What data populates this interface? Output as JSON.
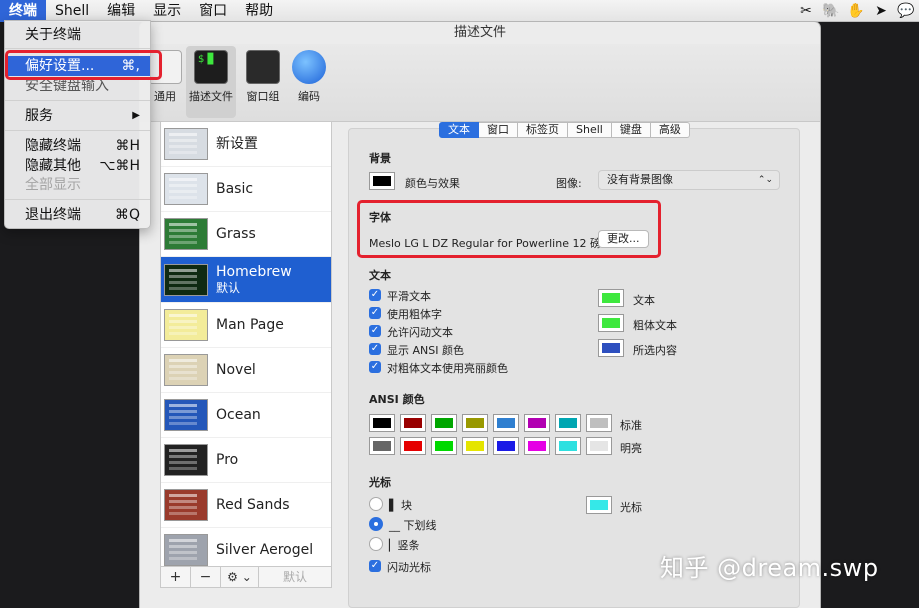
{
  "menubar": {
    "app": "终端",
    "items": [
      "Shell",
      "编辑",
      "显示",
      "窗口",
      "帮助"
    ],
    "status_icons": [
      "scissors-icon",
      "evernote-icon",
      "hand-icon",
      "send-icon",
      "wechat-icon"
    ]
  },
  "app_menu": {
    "items": [
      {
        "label": "关于终端",
        "shortcut": ""
      },
      {
        "label": "偏好设置...",
        "shortcut": "⌘,"
      },
      {
        "label": "安全键盘输入",
        "shortcut": ""
      },
      {
        "label": "服务",
        "shortcut": "▶"
      },
      {
        "label": "隐藏终端",
        "shortcut": "⌘H"
      },
      {
        "label": "隐藏其他",
        "shortcut": "⌥⌘H"
      },
      {
        "label": "全部显示",
        "shortcut": ""
      },
      {
        "label": "退出终端",
        "shortcut": "⌘Q"
      }
    ]
  },
  "window": {
    "title": "描述文件",
    "toolbar": [
      "通用",
      "描述文件",
      "窗口组",
      "编码"
    ]
  },
  "profiles": [
    {
      "name": "新设置",
      "sub": "",
      "thumb": "#d7dce2"
    },
    {
      "name": "Basic",
      "sub": "",
      "thumb": "#dde3ea"
    },
    {
      "name": "Grass",
      "sub": "",
      "thumb": "#2d7b36"
    },
    {
      "name": "Homebrew",
      "sub": "默认",
      "thumb": "#0f2a12"
    },
    {
      "name": "Man Page",
      "sub": "",
      "thumb": "#f3ec9a"
    },
    {
      "name": "Novel",
      "sub": "",
      "thumb": "#dcd2b5"
    },
    {
      "name": "Ocean",
      "sub": "",
      "thumb": "#2457b9"
    },
    {
      "name": "Pro",
      "sub": "",
      "thumb": "#222222"
    },
    {
      "name": "Red Sands",
      "sub": "",
      "thumb": "#9a3b2c"
    },
    {
      "name": "Silver Aerogel",
      "sub": "",
      "thumb": "#9ea3ad"
    }
  ],
  "list_buttons": {
    "add": "+",
    "remove": "−",
    "gear": "⚙ ⌄",
    "default": "默认"
  },
  "tabs": [
    {
      "label": "文本",
      "active": true
    },
    {
      "label": "窗口",
      "active": false
    },
    {
      "label": "标签页",
      "active": false
    },
    {
      "label": "Shell",
      "active": false
    },
    {
      "label": "键盘",
      "active": false
    },
    {
      "label": "高级",
      "active": false
    }
  ],
  "background": {
    "title": "背景",
    "color_effects": "颜色与效果",
    "image_label": "图像:",
    "image_value": "没有背景图像"
  },
  "font": {
    "title": "字体",
    "value": "Meslo LG L DZ Regular for Powerline 12 磅",
    "change": "更改..."
  },
  "text": {
    "title": "文本",
    "checkboxes": [
      "平滑文本",
      "使用粗体字",
      "允许闪动文本",
      "显示 ANSI 颜色",
      "对粗体文本使用亮丽颜色"
    ],
    "colors": [
      {
        "label": "文本",
        "color": "#3ee83e"
      },
      {
        "label": "粗体文本",
        "color": "#3ee83e"
      },
      {
        "label": "所选内容",
        "color": "#2d4fbf"
      }
    ]
  },
  "ansi": {
    "title": "ANSI 颜色",
    "normal_label": "标准",
    "bright_label": "明亮",
    "normal": [
      "#000000",
      "#990000",
      "#00a600",
      "#999900",
      "#2f7fd0",
      "#b200b2",
      "#00a6b2",
      "#bfbfbf"
    ],
    "bright": [
      "#666666",
      "#e50000",
      "#00d900",
      "#e5e500",
      "#1a1ae6",
      "#e500e5",
      "#2ee0e0",
      "#e5e5e5"
    ]
  },
  "cursor": {
    "title": "光标",
    "options": [
      "▌ 块",
      "__ 下划线",
      "▏竖条"
    ],
    "blink": "闪动光标",
    "color_label": "光标",
    "color": "#35e8e8"
  },
  "watermark": "知乎 @dream.swp"
}
